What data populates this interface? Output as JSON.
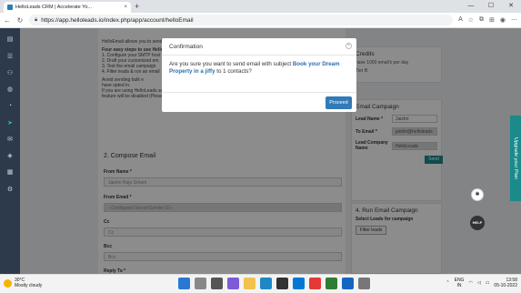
{
  "browser": {
    "tab_title": "HelloLeads CRM | Accelerate Yo...",
    "tab_close": "×",
    "new_tab": "+",
    "url": "https://app.helloleads.io/index.php/app/account/helloEmail",
    "win_min": "—",
    "win_max": "☐",
    "win_close": "✕"
  },
  "page": {
    "intro": "HelloEmail allows you to send",
    "steps_title": "Four easy steps to use Hello",
    "step1": "1. Configure your SMTP host",
    "step2": "2. Draft your customized em",
    "step3": "3. Test the email campaign",
    "step4": "4. Filter leads & run an email",
    "avoid_note": "Avoid sending bulk e",
    "avoid_note2": "have opted in.",
    "server_note": "If you are using HelloLeads server to send emails and if the bounce rate is more than 5% this Hello Email",
    "server_note2": "feature will be disabled (Please use any server to send emails).",
    "compose_title": "2. Compose Email",
    "from_name_label": "From Name *",
    "from_name_value": "Jaishri Raju Sriram",
    "from_email_label": "From Email *",
    "from_email_value": "--Configured Server/Sender ID--",
    "cc_label": "Cc",
    "cc_placeholder": "Cc",
    "bcc_label": "Bcc",
    "bcc_placeholder": "Bcc",
    "reply_to_label": "Reply To *"
  },
  "right": {
    "credits_title": "Credits",
    "credits_text": "have 1000 email's per day",
    "credits_text2": "Tier B",
    "test_title": "Email Campaign",
    "lead_name_label": "Lead Name *",
    "lead_name_value": "Jaishri",
    "to_email_label": "To Email *",
    "to_email_value": "jaishri@helloleads",
    "lead_company_label": "Lead Company Name",
    "lead_company_value": "HelloLeads",
    "send_label": "Send",
    "run_title": "4. Run Email Campaign",
    "select_leads_label": "Select Leads for campaign",
    "filter_leads_label": "Filter leads"
  },
  "upgrade_label": "Upgrade your Plan",
  "help_label": "HELP",
  "modal": {
    "title": "Confirmation",
    "close": "×",
    "message_pre": "Are you sure you want to send email with subject",
    "subject": "Book your Dream Property in a jiffy",
    "message_post": "to 1 contacts?",
    "proceed_label": "Proceed"
  },
  "taskbar": {
    "temp": "30°C",
    "weather": "Mostly cloudy",
    "lang1": "ENG",
    "lang2": "IN",
    "time": "13:58",
    "date": "05-10-2022"
  }
}
